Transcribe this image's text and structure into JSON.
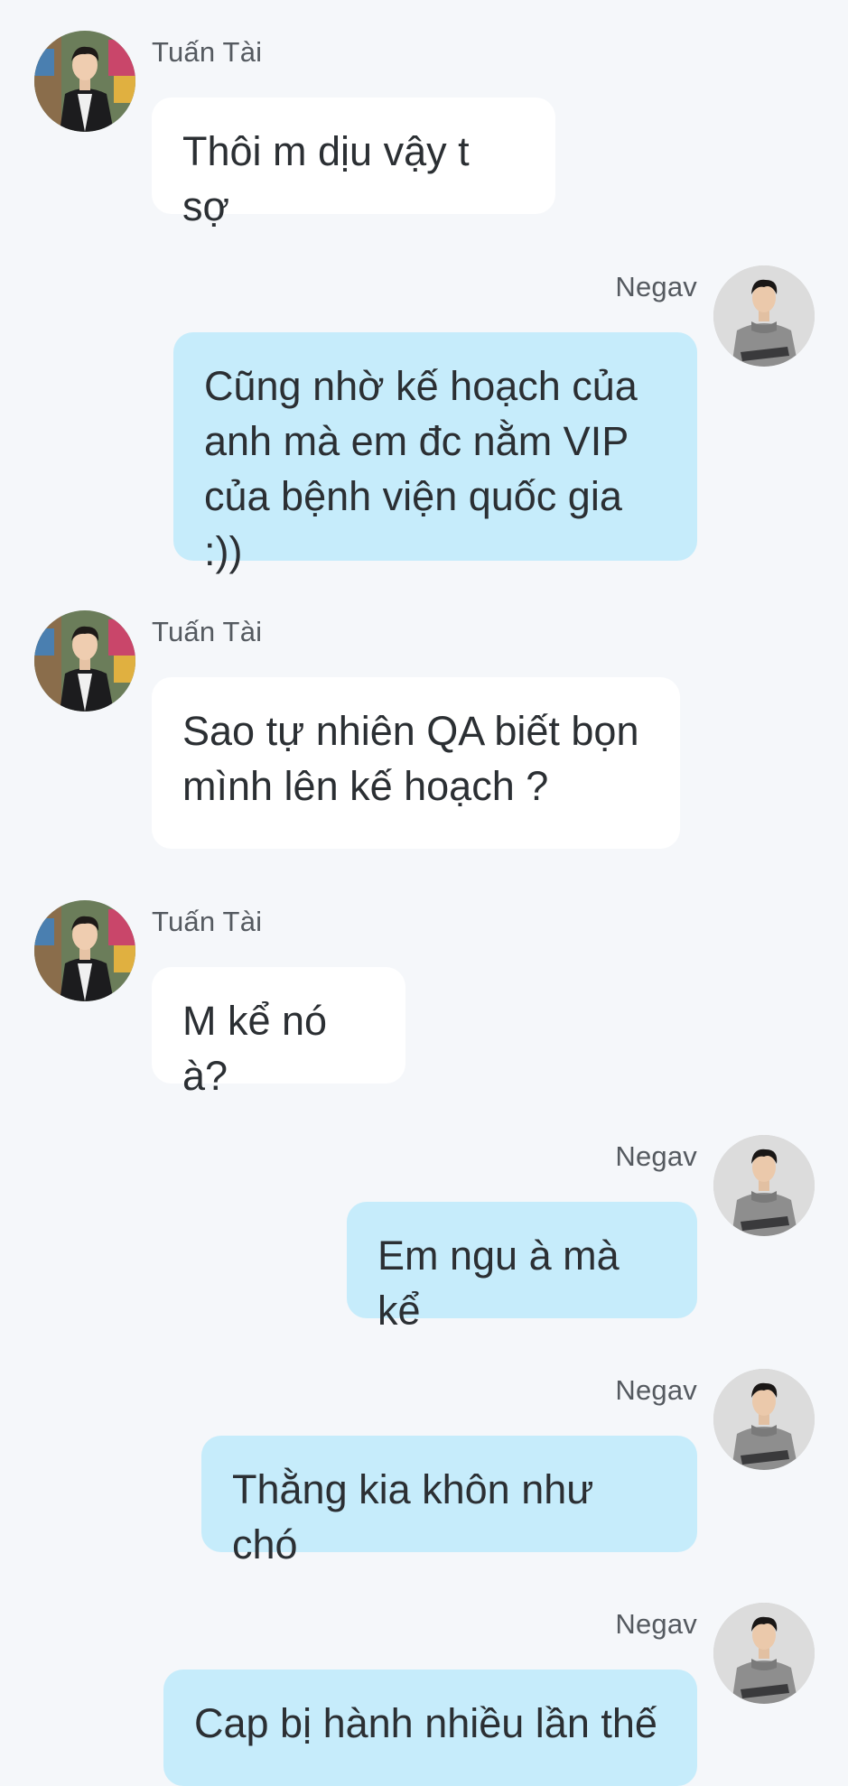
{
  "colors": {
    "background": "#f5f7fa",
    "incoming_bubble": "#ffffff",
    "outgoing_bubble": "#c6ecfb",
    "text": "#2b2f33",
    "sender_name": "#555a60"
  },
  "messages": [
    {
      "sender": "Tuấn Tài",
      "direction": "incoming",
      "avatar_icon": "avatar-tuan-tai-icon",
      "text": "Thôi m dịu vậy t sợ"
    },
    {
      "sender": "Negav",
      "direction": "outgoing",
      "avatar_icon": "avatar-negav-icon",
      "text": "Cũng nhờ kế hoạch của\nanh mà em đc nằm VIP\ncủa bệnh viện quốc gia :))"
    },
    {
      "sender": "Tuấn Tài",
      "direction": "incoming",
      "avatar_icon": "avatar-tuan-tai-icon",
      "text": "Sao tự nhiên QA biết bọn\nmình lên kế hoạch ?"
    },
    {
      "sender": "Tuấn Tài",
      "direction": "incoming",
      "avatar_icon": "avatar-tuan-tai-icon",
      "text": "M kể nó à?"
    },
    {
      "sender": "Negav",
      "direction": "outgoing",
      "avatar_icon": "avatar-negav-icon",
      "text": "Em ngu à mà kể"
    },
    {
      "sender": "Negav",
      "direction": "outgoing",
      "avatar_icon": "avatar-negav-icon",
      "text": "Thằng kia khôn như chó"
    },
    {
      "sender": "Negav",
      "direction": "outgoing",
      "avatar_icon": "avatar-negav-icon",
      "text": "Cap bị hành nhiều lần thế"
    }
  ]
}
